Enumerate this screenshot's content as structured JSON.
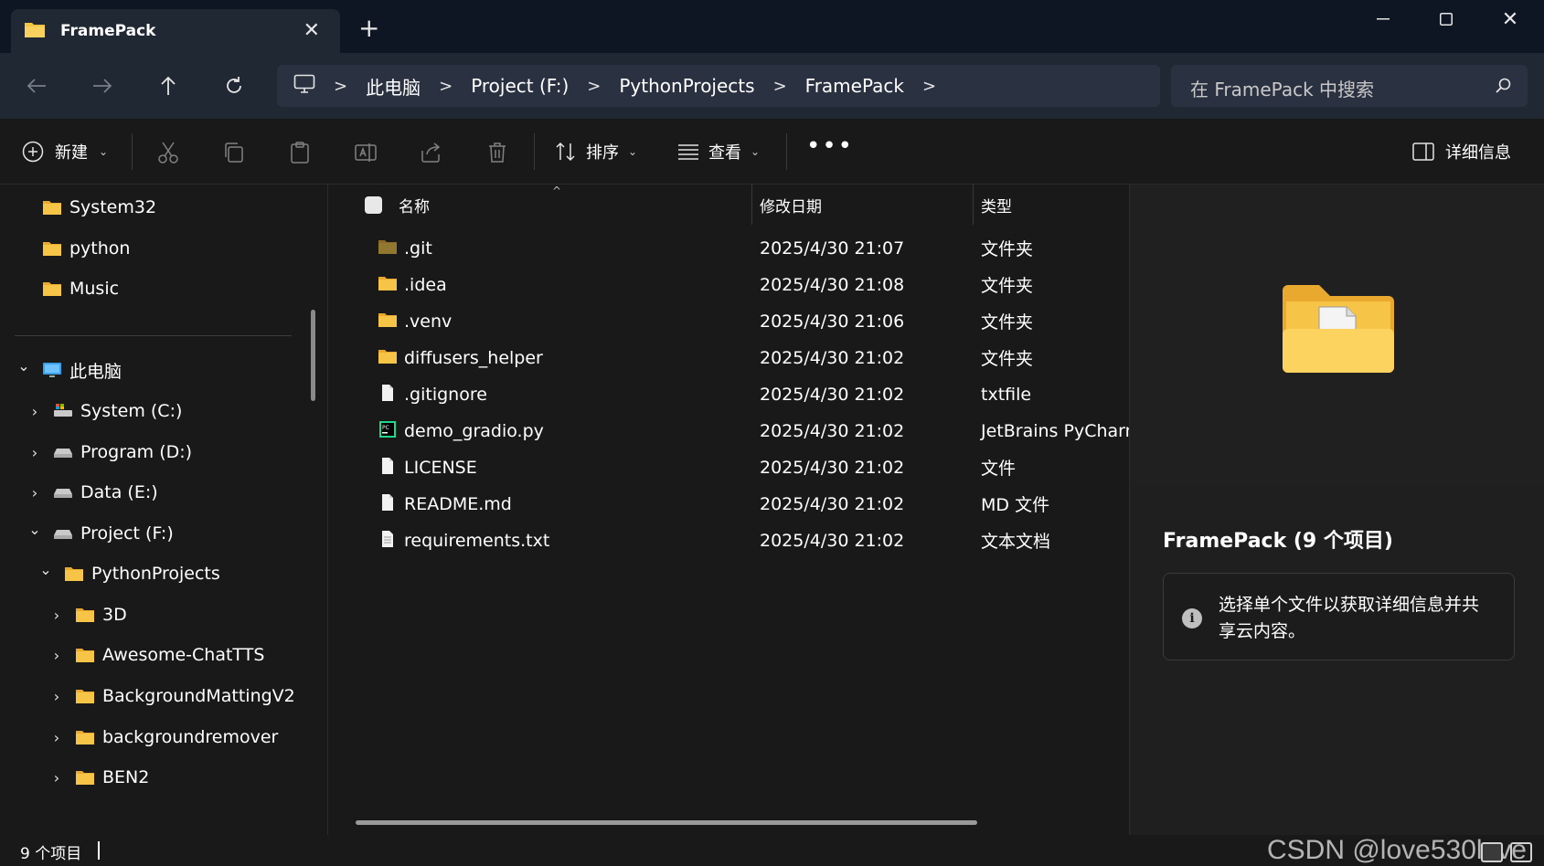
{
  "tab": {
    "title": "FramePack",
    "close_icon": "close-icon",
    "new_tab_label": "+"
  },
  "window_controls": {
    "minimize": "minimize-icon",
    "maximize": "maximize-icon",
    "close": "close-icon"
  },
  "address": {
    "root_icon": "computer-icon",
    "breadcrumbs": [
      "此电脑",
      "Project (F:)",
      "PythonProjects",
      "FramePack"
    ],
    "separator": ">"
  },
  "search": {
    "placeholder": "在 FramePack 中搜索"
  },
  "command_bar": {
    "new_label": "新建",
    "sort_label": "排序",
    "view_label": "查看",
    "more_label": "•••",
    "details_label": "详细信息"
  },
  "sidebar": {
    "items": [
      {
        "label": "System32",
        "icon": "folder-icon"
      },
      {
        "label": "python",
        "icon": "folder-icon"
      },
      {
        "label": "Music",
        "icon": "folder-icon"
      },
      {
        "label": "此电脑",
        "icon": "computer-icon",
        "chevron": "v"
      },
      {
        "label": "System (C:)",
        "icon": "system-drive-icon",
        "chevron": ">"
      },
      {
        "label": "Program (D:)",
        "icon": "drive-icon",
        "chevron": ">"
      },
      {
        "label": "Data (E:)",
        "icon": "drive-icon",
        "chevron": ">"
      },
      {
        "label": "Project (F:)",
        "icon": "drive-icon",
        "chevron": "v"
      },
      {
        "label": "PythonProjects",
        "icon": "folder-icon",
        "chevron": "v"
      },
      {
        "label": "3D",
        "icon": "folder-icon",
        "chevron": ">"
      },
      {
        "label": "Awesome-ChatTTS",
        "icon": "folder-icon",
        "chevron": ">"
      },
      {
        "label": "BackgroundMattingV2",
        "icon": "folder-icon",
        "chevron": ">"
      },
      {
        "label": "backgroundremover",
        "icon": "folder-icon",
        "chevron": ">"
      },
      {
        "label": "BEN2",
        "icon": "folder-icon",
        "chevron": ">"
      }
    ]
  },
  "file_list": {
    "columns": {
      "name": "名称",
      "date": "修改日期",
      "type": "类型"
    },
    "rows": [
      {
        "name": ".git",
        "date": "2025/4/30 21:07",
        "type": "文件夹",
        "icon": "folder-icon"
      },
      {
        "name": ".idea",
        "date": "2025/4/30 21:08",
        "type": "文件夹",
        "icon": "folder-icon"
      },
      {
        "name": ".venv",
        "date": "2025/4/30 21:06",
        "type": "文件夹",
        "icon": "folder-icon"
      },
      {
        "name": "diffusers_helper",
        "date": "2025/4/30 21:02",
        "type": "文件夹",
        "icon": "folder-icon"
      },
      {
        "name": ".gitignore",
        "date": "2025/4/30 21:02",
        "type": "txtfile",
        "icon": "file-icon"
      },
      {
        "name": "demo_gradio.py",
        "date": "2025/4/30 21:02",
        "type": "JetBrains PyCharm",
        "icon": "pycharm-file-icon"
      },
      {
        "name": "LICENSE",
        "date": "2025/4/30 21:02",
        "type": "文件",
        "icon": "file-icon"
      },
      {
        "name": "README.md",
        "date": "2025/4/30 21:02",
        "type": "MD 文件",
        "icon": "file-icon"
      },
      {
        "name": "requirements.txt",
        "date": "2025/4/30 21:02",
        "type": "文本文档",
        "icon": "text-file-icon"
      }
    ]
  },
  "details_pane": {
    "title": "FramePack (9 个项目)",
    "info_text": "选择单个文件以获取详细信息并共享云内容。",
    "info_icon": "info-icon"
  },
  "status_bar": {
    "count": "9 个项目"
  },
  "watermark": "CSDN @love530love",
  "colors": {
    "folder": "#f4c542",
    "titlebar": "#0f1623",
    "navbar": "#202833",
    "background": "#191919"
  }
}
